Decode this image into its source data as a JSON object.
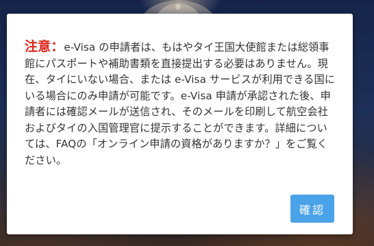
{
  "dialog": {
    "notice_label": "注意：",
    "message": "e-Visa の申請者は、もはやタイ王国大使館または総領事館にパスポートや補助書類を直接提出する必要はありません。現在、タイにいない場合、または e-Visa サービスが利用できる国にいる場合にのみ申請が可能です。e-Visa 申請が承認された後、申請者には確認メールが送信され、そのメールを印刷して航空会社およびタイの入国管理官に提示することができます。詳細については、FAQの「オンライン申請の資格がありますか？」をご覧ください。",
    "confirm_label": "確認"
  },
  "colors": {
    "notice_label": "#d9261c",
    "confirm_button": "#4aa3e8",
    "text": "#333333"
  }
}
